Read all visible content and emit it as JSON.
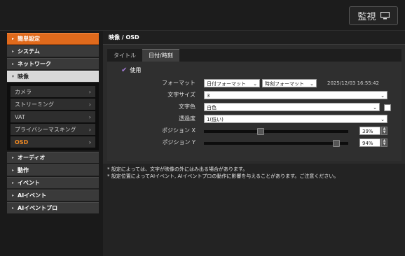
{
  "header": {
    "monitor_label": "監視"
  },
  "sidebar": {
    "items": [
      {
        "label": "簡単設定"
      },
      {
        "label": "システム"
      },
      {
        "label": "ネットワーク"
      },
      {
        "label": "映像"
      },
      {
        "label": "オーディオ"
      },
      {
        "label": "動作"
      },
      {
        "label": "イベント"
      },
      {
        "label": "AIイベント"
      },
      {
        "label": "AIイベントプロ"
      }
    ],
    "video_sub": [
      {
        "label": "カメラ"
      },
      {
        "label": "ストリーミング"
      },
      {
        "label": "VAT"
      },
      {
        "label": "プライバシーマスキング"
      },
      {
        "label": "OSD"
      }
    ]
  },
  "main": {
    "title": "映像 / OSD",
    "tabs": [
      {
        "label": "タイトル"
      },
      {
        "label": "日付/時刻"
      }
    ],
    "use_label": "使用",
    "format": {
      "label": "フォーマット",
      "date_format": "日付フォーマット",
      "time_format": "時刻フォーマット",
      "preview": "2025/12/03 16:55:42"
    },
    "font_size": {
      "label": "文字サイズ",
      "value": "3"
    },
    "text_color": {
      "label": "文字色",
      "value": "白色"
    },
    "transparency": {
      "label": "透過度",
      "value": "1(低い)"
    },
    "position_x": {
      "label": "ポジション X",
      "value": "39%",
      "level": 0.39
    },
    "position_y": {
      "label": "ポジション Y",
      "value": "94%",
      "level": 0.94
    }
  },
  "notes": [
    "* 設定によっては、文字が映像の外にはみ出る場合があります。",
    "* 設定位置によってAIイベント, AIイベントプロの動作に影響を与えることがあります。ご注意ください。"
  ],
  "colors": {
    "accent": "#e06a1c",
    "active_sub": "#f28a22",
    "check": "#a37bd6"
  }
}
